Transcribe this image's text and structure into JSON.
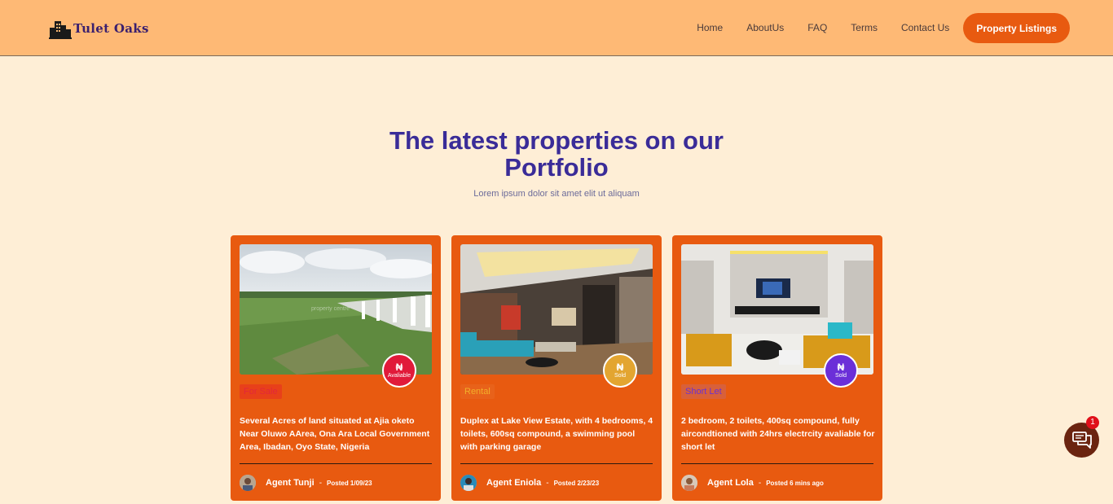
{
  "brand": {
    "name": "Tulet Oaks"
  },
  "nav": {
    "links": [
      "Home",
      "AboutUs",
      "FAQ",
      "Terms",
      "Contact Us"
    ],
    "cta": "Property Listings"
  },
  "hero": {
    "title_line1": "The latest properties on our",
    "title_line2": "Portfolio",
    "subtitle": "Lorem ipsum dolor sit amet elit ut aliquam"
  },
  "cards": [
    {
      "status_symbol": "₦",
      "status": "Avaliable",
      "status_color": "#e11a3a",
      "tag": "For Sale",
      "tag_text_color": "#e2283a",
      "description": "Several Acres of land situated at Ajia oketo Near Oluwo AArea, Ona Ara Local Government Area, Ibadan, Oyo State, Nigeria",
      "agent": "Agent Tunji",
      "posted": "Posted 1/09/23",
      "watermark": "property centre"
    },
    {
      "status_symbol": "₦",
      "status": "Sold",
      "status_color": "#e3a531",
      "tag": "Rental",
      "tag_text_color": "#f2b02a",
      "description": "Duplex at Lake View Estate, with 4 bedrooms, 4 toilets, 600sq compound, a swimming pool with parking garage",
      "agent": "Agent Eniola",
      "posted": "Posted 2/23/23"
    },
    {
      "status_symbol": "₦",
      "status": "Sold",
      "status_color": "#6b2fd8",
      "tag": "Short Let",
      "tag_text_color": "#6b32d1",
      "description": "2 bedroom, 2 toilets, 400sq compound, fully aircondtioned with 24hrs electrcity avaliable for short let",
      "agent": "Agent Lola",
      "posted": "Posted 6 mins ago"
    }
  ],
  "chat": {
    "unread_count": "1"
  },
  "icons": [
    "building-logo-icon",
    "chat-icon",
    "naira-icon"
  ]
}
